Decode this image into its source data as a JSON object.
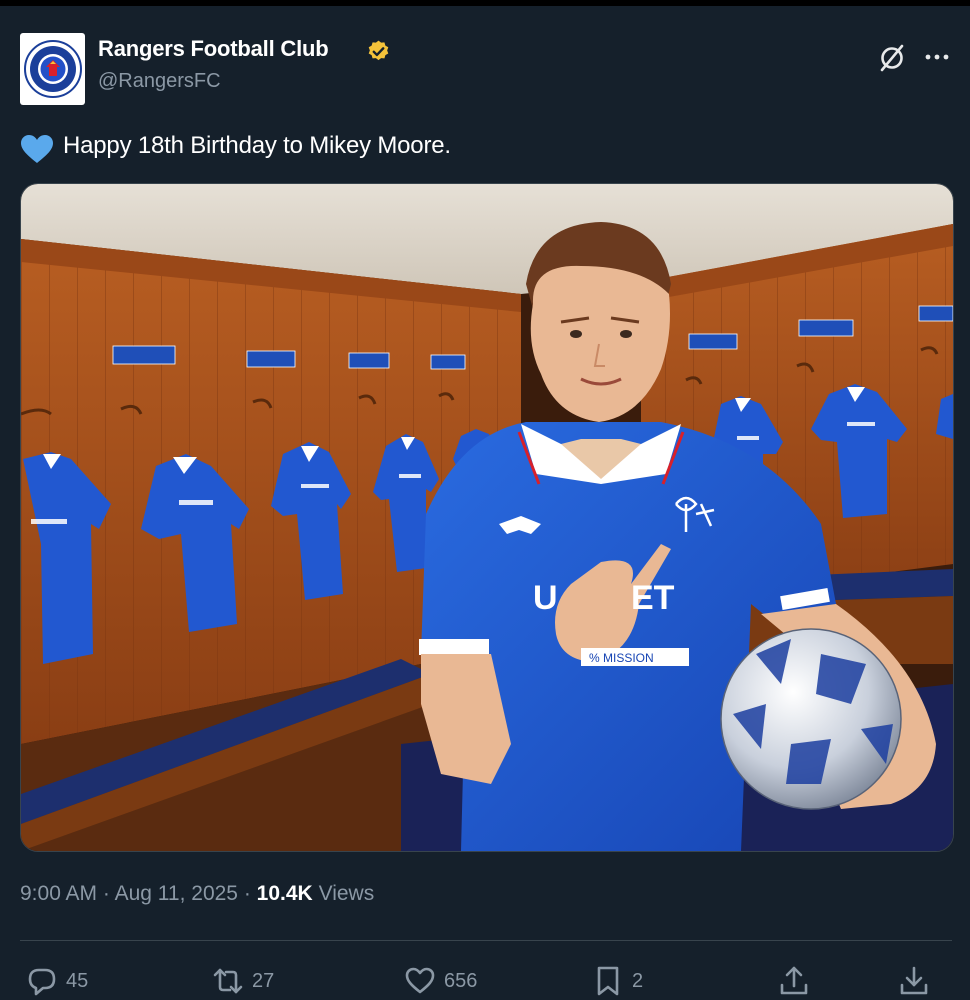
{
  "author": {
    "display_name": "Rangers Football Club",
    "handle": "@RangersFC",
    "avatar_icon": "rangers-crest-icon",
    "verified_icon": "gold-verified-badge-icon",
    "verified_color": "#f4c23a"
  },
  "tweet": {
    "emoji_icon": "blue-heart-emoji-icon",
    "text": "Happy 18th Birthday to Mikey Moore.",
    "image_alt": "Mikey Moore in a Rangers home shirt holding a football in the Ibrox dressing room"
  },
  "meta": {
    "time": "9:00 AM",
    "separator_1": "·",
    "date": "Aug 11, 2025",
    "separator_2": "·",
    "views_count": "10.4K",
    "views_label": "Views"
  },
  "actions": {
    "replies": "45",
    "reposts": "27",
    "likes": "656",
    "bookmarks": "2"
  },
  "colors": {
    "background": "#15202b",
    "secondary_text": "#8b98a5",
    "primary_text": "#ffffff",
    "divider": "#38444d",
    "rangers_blue": "#1f5fd6"
  }
}
